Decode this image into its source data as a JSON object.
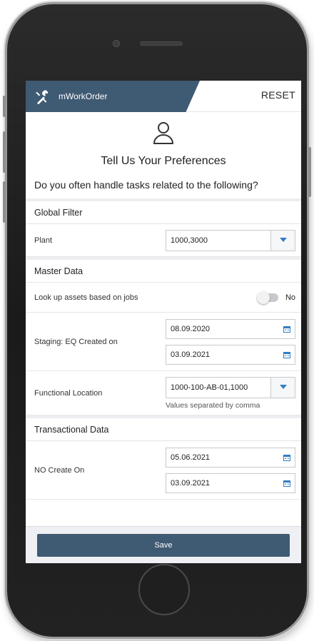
{
  "app": {
    "title": "mWorkOrder",
    "reset_label": "RESET",
    "logo_icon": "tools-icon",
    "brand_color": "#3f5a73"
  },
  "intro": {
    "heading": "Tell Us Your Preferences",
    "question": "Do you often handle tasks related to the following?",
    "profile_icon": "user-profile-icon"
  },
  "global_filter": {
    "section_title": "Global Filter",
    "plant_label": "Plant",
    "plant_value": "1000,3000"
  },
  "master_data": {
    "section_title": "Master Data",
    "lookup_label": "Look up assets based on jobs",
    "lookup_toggle_text": "No",
    "lookup_enabled": false,
    "staging_label": "Staging: EQ Created on",
    "staging_from": "08.09.2020",
    "staging_to": "03.09.2021",
    "functional_location_label": "Functional Location",
    "functional_location_value": "1000-100-AB-01,1000",
    "functional_location_hint": "Values separated by comma"
  },
  "transactional_data": {
    "section_title": "Transactional Data",
    "no_create_label": "NO Create On",
    "no_create_from": "05.06.2021",
    "no_create_to": "03.09.2021"
  },
  "footer": {
    "save_label": "Save"
  }
}
